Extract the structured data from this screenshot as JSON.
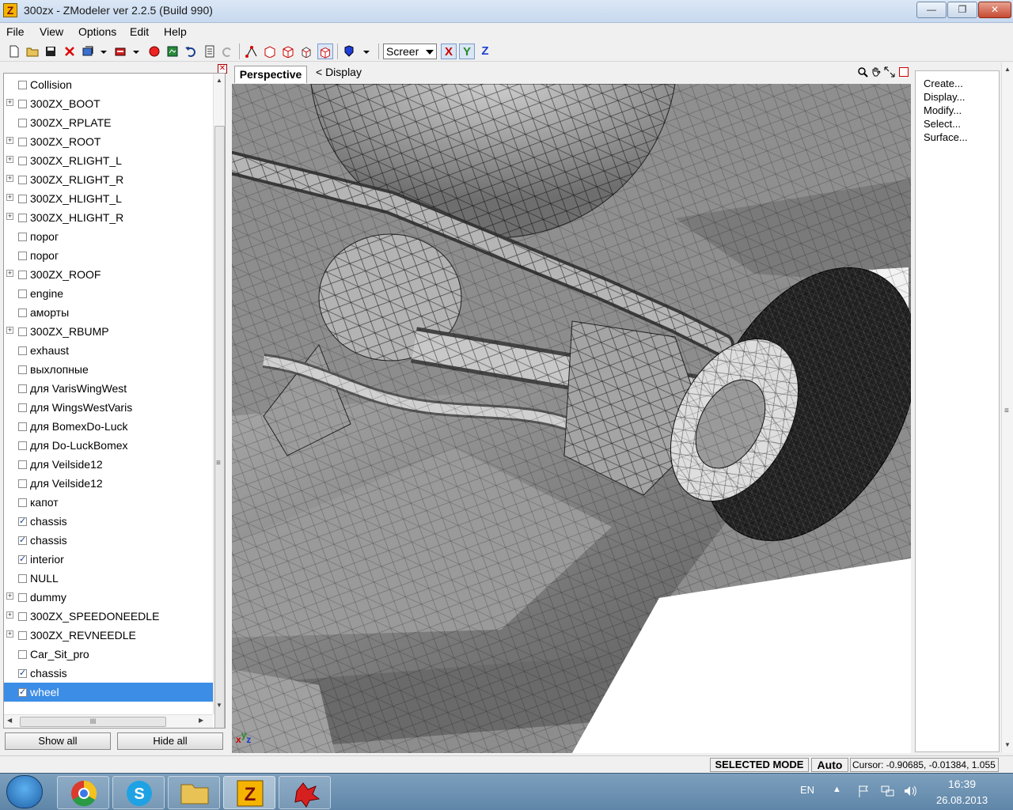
{
  "window": {
    "title": "300zx - ZModeler ver 2.2.5 (Build 990)",
    "app_icon_letter": "Z",
    "close_glyph": "✕",
    "max_glyph": "❐",
    "min_glyph": "—"
  },
  "menu": {
    "file": "File",
    "view": "View",
    "options": "Options",
    "edit": "Edit",
    "help": "Help"
  },
  "toolbar": {
    "screen_select": "Screer",
    "axis_x": "X",
    "axis_y": "Y",
    "axis_z": "Z"
  },
  "tree": {
    "items": [
      {
        "label": "Collision",
        "expandable": false,
        "checked": false
      },
      {
        "label": "300ZX_BOOT",
        "expandable": true,
        "checked": false
      },
      {
        "label": "300ZX_RPLATE",
        "expandable": false,
        "checked": false
      },
      {
        "label": "300ZX_ROOT",
        "expandable": true,
        "checked": false
      },
      {
        "label": "300ZX_RLIGHT_L",
        "expandable": true,
        "checked": false
      },
      {
        "label": "300ZX_RLIGHT_R",
        "expandable": true,
        "checked": false
      },
      {
        "label": "300ZX_HLIGHT_L",
        "expandable": true,
        "checked": false
      },
      {
        "label": "300ZX_HLIGHT_R",
        "expandable": true,
        "checked": false
      },
      {
        "label": "порог",
        "expandable": false,
        "checked": false
      },
      {
        "label": "порог",
        "expandable": false,
        "checked": false
      },
      {
        "label": "300ZX_ROOF",
        "expandable": true,
        "checked": false
      },
      {
        "label": "engine",
        "expandable": false,
        "checked": false
      },
      {
        "label": "аморты",
        "expandable": false,
        "checked": false
      },
      {
        "label": "300ZX_RBUMP",
        "expandable": true,
        "checked": false
      },
      {
        "label": "exhaust",
        "expandable": false,
        "checked": false
      },
      {
        "label": "выхлопные",
        "expandable": false,
        "checked": false
      },
      {
        "label": "для VarisWingWest",
        "expandable": false,
        "checked": false
      },
      {
        "label": "для WingsWestVaris",
        "expandable": false,
        "checked": false
      },
      {
        "label": "для BomexDo-Luck",
        "expandable": false,
        "checked": false
      },
      {
        "label": "для Do-LuckBomex",
        "expandable": false,
        "checked": false
      },
      {
        "label": "для Veilside12",
        "expandable": false,
        "checked": false
      },
      {
        "label": "для Veilside12",
        "expandable": false,
        "checked": false
      },
      {
        "label": "капот",
        "expandable": false,
        "checked": false
      },
      {
        "label": "chassis",
        "expandable": false,
        "checked": true
      },
      {
        "label": "chassis",
        "expandable": false,
        "checked": true
      },
      {
        "label": "interior",
        "expandable": false,
        "checked": true
      },
      {
        "label": "NULL",
        "expandable": false,
        "checked": false
      },
      {
        "label": "dummy",
        "expandable": true,
        "checked": false
      },
      {
        "label": "300ZX_SPEEDONEEDLE",
        "expandable": true,
        "checked": false
      },
      {
        "label": "300ZX_REVNEEDLE",
        "expandable": true,
        "checked": false
      },
      {
        "label": "Car_Sit_pro",
        "expandable": false,
        "checked": false
      },
      {
        "label": "chassis",
        "expandable": false,
        "checked": true
      },
      {
        "label": "wheel",
        "expandable": false,
        "checked": true,
        "selected": true
      }
    ],
    "show_all": "Show all",
    "hide_all": "Hide all",
    "expand_glyph": "+",
    "check_glyph": "✓",
    "hscroll_grip": "III",
    "vscroll_grip": "≡"
  },
  "viewport": {
    "tab_label": "Perspective",
    "display_label": "<  Display",
    "gizmo": {
      "x": "x",
      "y": "y",
      "z": "z"
    }
  },
  "right_panel": {
    "items": [
      "Create...",
      "Display...",
      "Modify...",
      "Select...",
      "Surface..."
    ]
  },
  "status": {
    "mode": "SELECTED MODE",
    "auto": "Auto",
    "cursor": "Cursor: -0.90685, -0.01384, 1.055"
  },
  "taskbar": {
    "lang": "EN",
    "time": "16:39",
    "date": "26.08.2013"
  },
  "colors": {
    "selection": "#3b8de6",
    "viewport_bg": "#ffffff",
    "mesh_gray": "#8c8c8c",
    "tire": "#1e1e1e"
  }
}
